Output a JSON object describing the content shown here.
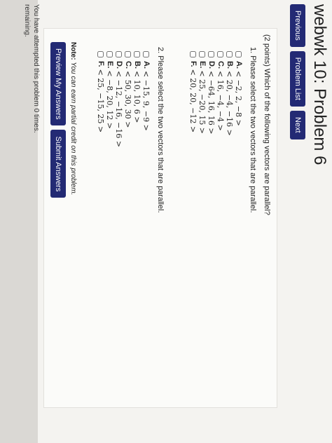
{
  "header": {
    "title": "webwk 10: Problem 6",
    "nav": {
      "previous": "Previous",
      "problem_list": "Problem List",
      "next": "Next"
    }
  },
  "problem": {
    "intro": "(2 points) Which of the following vectors are parallel?",
    "parts": [
      {
        "title": "1. Please select the two vectors that are parallel.",
        "options": [
          {
            "label": "A.",
            "vector": "< −2, 2, −8 >"
          },
          {
            "label": "B.",
            "vector": "< 20, −4, −16 >"
          },
          {
            "label": "C.",
            "vector": "< 16, −4, −4 >"
          },
          {
            "label": "D.",
            "vector": "< −64, 16, 16 >"
          },
          {
            "label": "E.",
            "vector": "< 25, −20, 15 >"
          },
          {
            "label": "F.",
            "vector": "< 20, 20, −12 >"
          }
        ]
      },
      {
        "title": "2. Please select the two vectors that are parallel.",
        "options": [
          {
            "label": "A.",
            "vector": "< −15, 9, −9 >"
          },
          {
            "label": "B.",
            "vector": "< 10, 10, 6 >"
          },
          {
            "label": "C.",
            "vector": "< 50, 30, 30 >"
          },
          {
            "label": "D.",
            "vector": "< −12, −16, −16 >"
          },
          {
            "label": "E.",
            "vector": "< −8, 20, 12 >"
          },
          {
            "label": "F.",
            "vector": "< 25, −15, 25 >"
          }
        ]
      }
    ]
  },
  "footer": {
    "note_label": "Note:",
    "note_text": "You can earn partial credit on this problem.",
    "preview_button": "Preview My Answers",
    "submit_button": "Submit Answers",
    "attempts_text": "You have attempted this problem 0 times.",
    "remaining_text": "remaining."
  }
}
